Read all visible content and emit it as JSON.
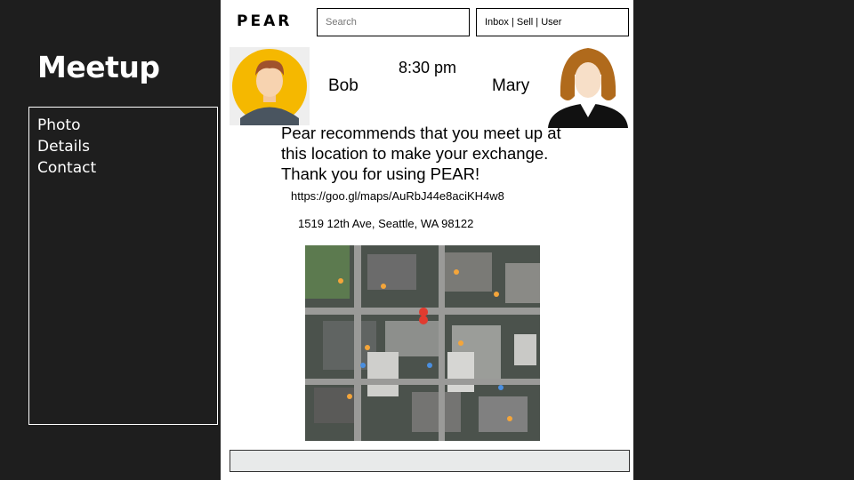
{
  "page": {
    "title": "Meetup"
  },
  "sidebar": {
    "items": [
      {
        "label": "Photo"
      },
      {
        "label": "Details"
      },
      {
        "label": "Contact"
      }
    ]
  },
  "header": {
    "logo": "PEAR",
    "search_placeholder": "Search",
    "nav": "Inbox | Sell | User"
  },
  "meetup": {
    "time": "8:30 pm",
    "buyer": "Bob",
    "seller": "Mary",
    "message": "Pear recommends that you meet up at this location to make your exchange. Thank you for using PEAR!",
    "link": "https://goo.gl/maps/AuRbJ44e8aciKH4w8",
    "address": "1519 12th Ave, Seattle, WA 98122"
  },
  "icons": {
    "bob_avatar": "male-avatar-icon",
    "mary_avatar": "female-avatar-icon",
    "map": "map-icon"
  },
  "colors": {
    "background": "#1e1e1e",
    "avatar_yellow": "#f5b800",
    "map_pin": "#e03b2f"
  }
}
